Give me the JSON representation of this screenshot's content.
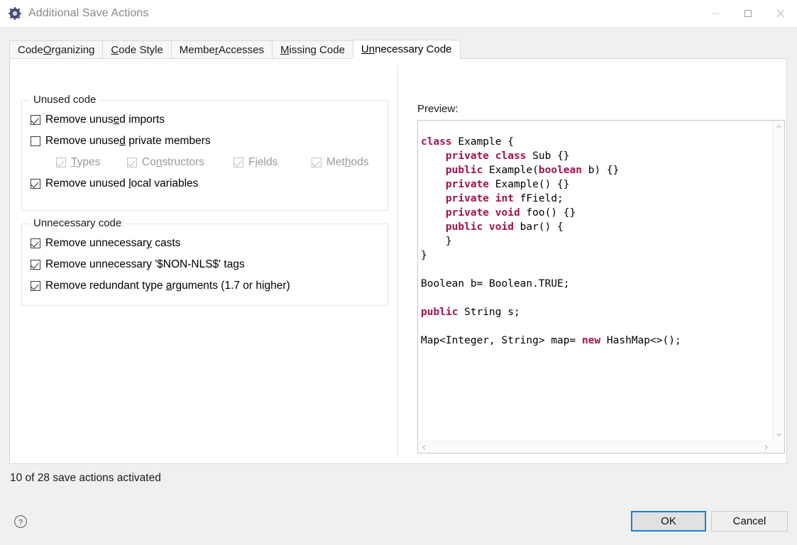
{
  "window": {
    "title": "Additional Save Actions",
    "icon": "gear-icon",
    "minimize_label": "–",
    "maximize_label": "☐",
    "close_label": "×"
  },
  "tabs": [
    {
      "label": "Code Organizing",
      "mnemonic": "O",
      "active": false
    },
    {
      "label": "Code Style",
      "mnemonic": "C",
      "active": false
    },
    {
      "label": "Member Accesses",
      "mnemonic": "r",
      "active": false
    },
    {
      "label": "Missing Code",
      "mnemonic": "M",
      "active": false
    },
    {
      "label": "Unnecessary Code",
      "mnemonic": "Un",
      "active": true
    }
  ],
  "groups": [
    {
      "title": "Unused code",
      "options": [
        {
          "label": "Remove unused imports",
          "checked": true,
          "enabled": true
        },
        {
          "label": "Remove unused private members",
          "checked": false,
          "enabled": true
        },
        {
          "label": "Remove unused local variables",
          "checked": true,
          "enabled": true
        }
      ],
      "sub_options": [
        {
          "label": "Types",
          "checked": true,
          "enabled": false
        },
        {
          "label": "Constructors",
          "checked": true,
          "enabled": false
        },
        {
          "label": "Fields",
          "checked": true,
          "enabled": false
        },
        {
          "label": "Methods",
          "checked": true,
          "enabled": false
        }
      ]
    },
    {
      "title": "Unnecessary code",
      "options": [
        {
          "label": "Remove unnecessary casts",
          "checked": true,
          "enabled": true
        },
        {
          "label": "Remove unnecessary '$NON-NLS$' tags",
          "checked": true,
          "enabled": true
        },
        {
          "label": "Remove redundant type arguments (1.7 or higher)",
          "checked": true,
          "enabled": true
        }
      ]
    }
  ],
  "preview": {
    "label": "Preview:",
    "keyword_color": "#a4114f",
    "lines": [
      [
        {
          "t": "class",
          "k": true
        },
        {
          "t": " Example {",
          "k": false
        }
      ],
      [
        {
          "t": "    ",
          "k": false
        },
        {
          "t": "private class",
          "k": true
        },
        {
          "t": " Sub {}",
          "k": false
        }
      ],
      [
        {
          "t": "    ",
          "k": false
        },
        {
          "t": "public",
          "k": true
        },
        {
          "t": " Example(",
          "k": false
        },
        {
          "t": "boolean",
          "k": true
        },
        {
          "t": " b) {}",
          "k": false
        }
      ],
      [
        {
          "t": "    ",
          "k": false
        },
        {
          "t": "private",
          "k": true
        },
        {
          "t": " Example() {}",
          "k": false
        }
      ],
      [
        {
          "t": "    ",
          "k": false
        },
        {
          "t": "private int",
          "k": true
        },
        {
          "t": " fField;",
          "k": false
        }
      ],
      [
        {
          "t": "    ",
          "k": false
        },
        {
          "t": "private void",
          "k": true
        },
        {
          "t": " foo() {}",
          "k": false
        }
      ],
      [
        {
          "t": "    ",
          "k": false
        },
        {
          "t": "public void",
          "k": true
        },
        {
          "t": " bar() {",
          "k": false
        }
      ],
      [
        {
          "t": "    }",
          "k": false
        }
      ],
      [
        {
          "t": "}",
          "k": false
        }
      ],
      [
        {
          "t": "",
          "k": false
        }
      ],
      [
        {
          "t": "Boolean b= Boolean.TRUE;",
          "k": false
        }
      ],
      [
        {
          "t": "",
          "k": false
        }
      ],
      [
        {
          "t": "public",
          "k": true
        },
        {
          "t": " String s;",
          "k": false
        }
      ],
      [
        {
          "t": "",
          "k": false
        }
      ],
      [
        {
          "t": "Map<Integer, String> map= ",
          "k": false
        },
        {
          "t": "new",
          "k": true
        },
        {
          "t": " HashMap<>();",
          "k": false
        }
      ]
    ]
  },
  "status": "10 of 28 save actions activated",
  "footer": {
    "help_label": "?",
    "ok_label": "OK",
    "cancel_label": "Cancel"
  }
}
